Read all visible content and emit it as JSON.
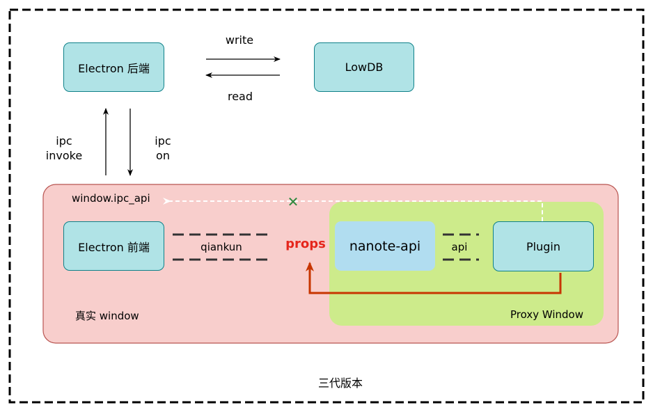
{
  "diagram": {
    "caption": "三代版本",
    "nodes": {
      "electron_backend": "Electron 后端",
      "lowdb": "LowDB",
      "electron_frontend": "Electron 前端",
      "nanote_api": "nanote-api",
      "plugin": "Plugin"
    },
    "edges": {
      "write": "write",
      "read": "read",
      "ipc_invoke_line1": "ipc",
      "ipc_invoke_line2": "invoke",
      "ipc_on_line1": "ipc",
      "ipc_on_line2": "on",
      "qiankun": "qiankun",
      "api": "api",
      "props": "props",
      "blocked_mark": "✕"
    },
    "regions": {
      "real_window_api": "window.ipc_api",
      "real_window": "真实 window",
      "proxy_window": "Proxy Window"
    },
    "colors": {
      "teal_fill": "#b0e3e6",
      "teal_stroke": "#0e8088",
      "red_region": "#f8cecc",
      "red_stroke": "#b85450",
      "green_region": "#cdeb8b",
      "blue_node": "#b1ddf0",
      "props_red": "#e5261c",
      "arrow_red": "#c73500",
      "cross_green": "#2d8a3e"
    }
  }
}
